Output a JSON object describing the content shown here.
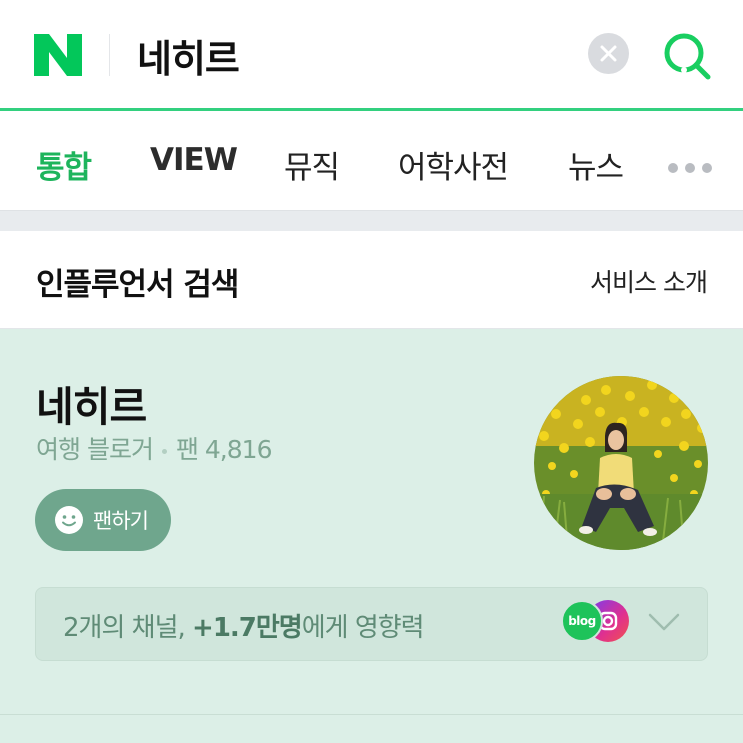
{
  "header": {
    "logo_icon": "naver-n-logo",
    "query": "네히르",
    "clear_icon": "clear-x-icon",
    "search_icon": "search-icon",
    "accent_color": "#33d07f"
  },
  "tabs": [
    {
      "label": "통합"
    },
    {
      "label": "VIEW"
    },
    {
      "label": "뮤직"
    },
    {
      "label": "어학사전"
    },
    {
      "label": "뉴스"
    }
  ],
  "tabs_more_icon": "more-dots-icon",
  "section": {
    "title": "인플루언서 검색",
    "link": "서비스 소개"
  },
  "influencer": {
    "name": "네히르",
    "category": "여행 블로거",
    "fans_label": "팬 4,816",
    "fan_button_label": "팬하기",
    "fan_button_icon": "smile-icon",
    "avatar_icon": "profile-photo",
    "channel_text_pre": "2개의 채널, ",
    "channel_text_bold": "+1.7만명",
    "channel_text_post": "에게 영향력",
    "blog_badge": "blog",
    "instagram_icon": "instagram-icon",
    "expand_icon": "chevron-down-icon"
  }
}
